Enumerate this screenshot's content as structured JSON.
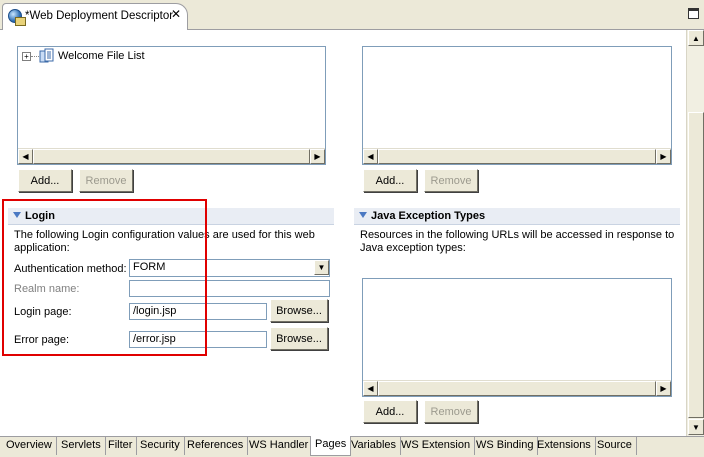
{
  "editor": {
    "title": "*Web Deployment Descriptor",
    "close_glyph": "✕"
  },
  "welcome_files": {
    "tree_item": "Welcome File List",
    "add_label": "Add...",
    "remove_label": "Remove"
  },
  "right_top": {
    "add_label": "Add...",
    "remove_label": "Remove"
  },
  "login": {
    "title": "Login",
    "description": "The following Login configuration values are used for this web application:",
    "auth_label": "Authentication method:",
    "auth_value": "FORM",
    "realm_label": "Realm name:",
    "realm_value": "",
    "login_page_label": "Login page:",
    "login_page_value": "/login.jsp",
    "error_page_label": "Error page:",
    "error_page_value": "/error.jsp",
    "browse_label": "Browse..."
  },
  "java_exceptions": {
    "title": "Java Exception Types",
    "description": "Resources in the following URLs will be accessed in response to Java exception types:",
    "add_label": "Add...",
    "remove_label": "Remove"
  },
  "page_tabs": [
    "Overview",
    "Servlets",
    "Filter",
    "Security",
    "References",
    "WS Handler",
    "Pages",
    "Variables",
    "WS Extension",
    "WS Binding",
    "Extensions",
    "Source"
  ],
  "active_tab": "Pages",
  "icons": {
    "tab": "web-descriptor-icon",
    "tree": "welcome-file-list-icon",
    "twisty": "section-expanded-icon"
  },
  "colors": {
    "annotation": "#e00000",
    "section_header": "#e9edf4"
  }
}
